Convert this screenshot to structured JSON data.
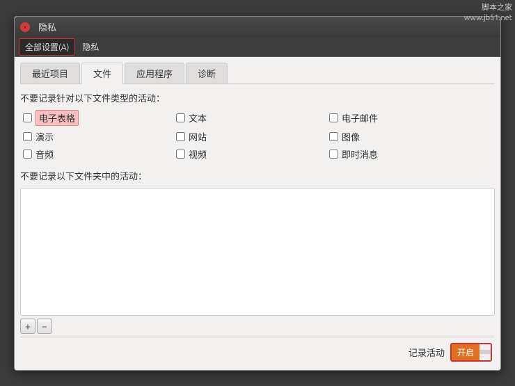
{
  "titlebar": {
    "title": "隐私",
    "close_label": "×"
  },
  "menubar": {
    "items": [
      {
        "label": "全部设置(A)",
        "active": true
      },
      {
        "label": "隐私",
        "active": false
      }
    ]
  },
  "tabs": [
    {
      "label": "最近项目",
      "active": false
    },
    {
      "label": "文件",
      "active": true
    },
    {
      "label": "应用程序",
      "active": false
    },
    {
      "label": "诊断",
      "active": false
    }
  ],
  "file_types_section": {
    "heading": "不要记录针对以下文件类型的活动：",
    "items": [
      {
        "label": "电子表格",
        "highlight": true,
        "checked": false
      },
      {
        "label": "文本",
        "highlight": false,
        "checked": false
      },
      {
        "label": "电子邮件",
        "highlight": false,
        "checked": false
      },
      {
        "label": "演示",
        "highlight": false,
        "checked": false
      },
      {
        "label": "网站",
        "highlight": false,
        "checked": false
      },
      {
        "label": "图像",
        "highlight": false,
        "checked": false
      },
      {
        "label": "音频",
        "highlight": false,
        "checked": false
      },
      {
        "label": "视频",
        "highlight": false,
        "checked": false
      },
      {
        "label": "即时消息",
        "highlight": false,
        "checked": false
      }
    ]
  },
  "folder_section": {
    "heading": "不要记录以下文件夹中的活动："
  },
  "toolbar": {
    "add_label": "+",
    "remove_label": "−"
  },
  "footer": {
    "record_label": "记录活动",
    "toggle_on": "开启",
    "toggle_off": ""
  },
  "watermark": {
    "line1": "脚本之家",
    "line2": "www.jb51.net"
  }
}
